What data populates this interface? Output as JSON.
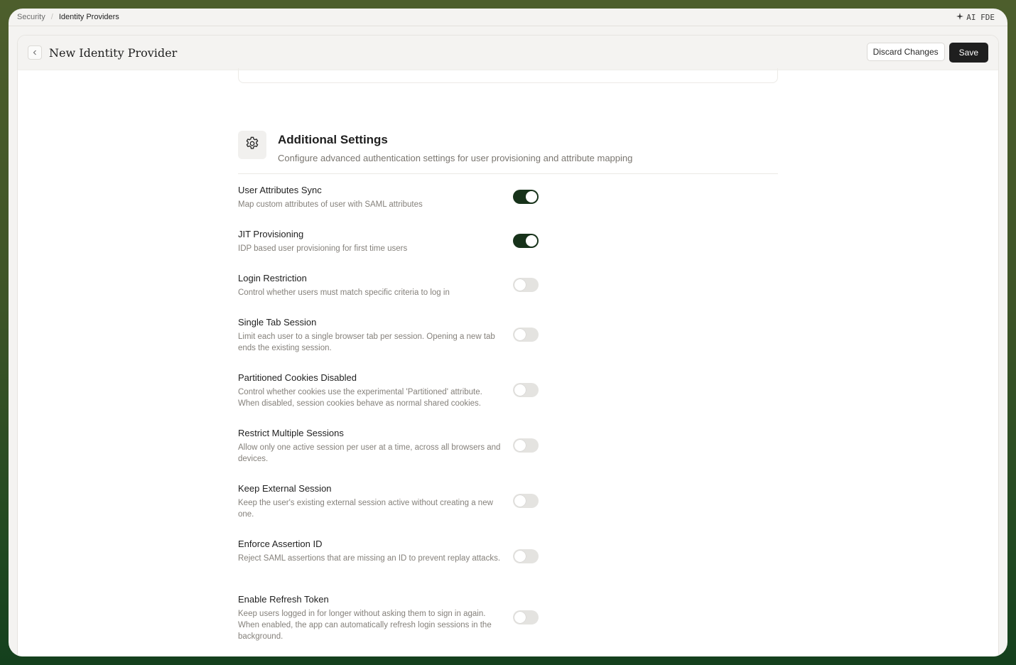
{
  "breadcrumb": {
    "root": "Security",
    "current": "Identity Providers"
  },
  "top_right": {
    "label": "AI FDE",
    "icon": "sparkle-icon"
  },
  "header": {
    "title": "New Identity Provider",
    "discard_label": "Discard Changes",
    "save_label": "Save"
  },
  "section": {
    "title": "Additional Settings",
    "description": "Configure advanced authentication settings for user provisioning and attribute mapping",
    "icon": "gear-icon"
  },
  "settings": [
    {
      "title": "User Attributes Sync",
      "description": "Map custom attributes of user with SAML attributes",
      "enabled": true
    },
    {
      "title": "JIT Provisioning",
      "description": "IDP based user provisioning for first time users",
      "enabled": true
    },
    {
      "title": "Login Restriction",
      "description": "Control whether users must match specific criteria to log in",
      "enabled": false
    },
    {
      "title": "Single Tab Session",
      "description": "Limit each user to a single browser tab per session. Opening a new tab ends the existing session.",
      "enabled": false
    },
    {
      "title": "Partitioned Cookies Disabled",
      "description": "Control whether cookies use the experimental 'Partitioned' attribute. When disabled, session cookies behave as normal shared cookies.",
      "enabled": false
    },
    {
      "title": "Restrict Multiple Sessions",
      "description": "Allow only one active session per user at a time, across all browsers and devices.",
      "enabled": false
    },
    {
      "title": "Keep External Session",
      "description": "Keep the user's existing external session active without creating a new one.",
      "enabled": false
    },
    {
      "title": "Enforce Assertion ID",
      "description": "Reject SAML assertions that are missing an ID to prevent replay attacks.",
      "enabled": false
    },
    {
      "title": "Enable Refresh Token",
      "description": "Keep users logged in for longer without asking them to sign in again. When enabled, the app can automatically refresh login sessions in the background.",
      "enabled": false
    }
  ],
  "colors": {
    "toggle_on": "#17321a",
    "toggle_off": "#e4e3e0",
    "save_bg": "#1f1f1f"
  }
}
